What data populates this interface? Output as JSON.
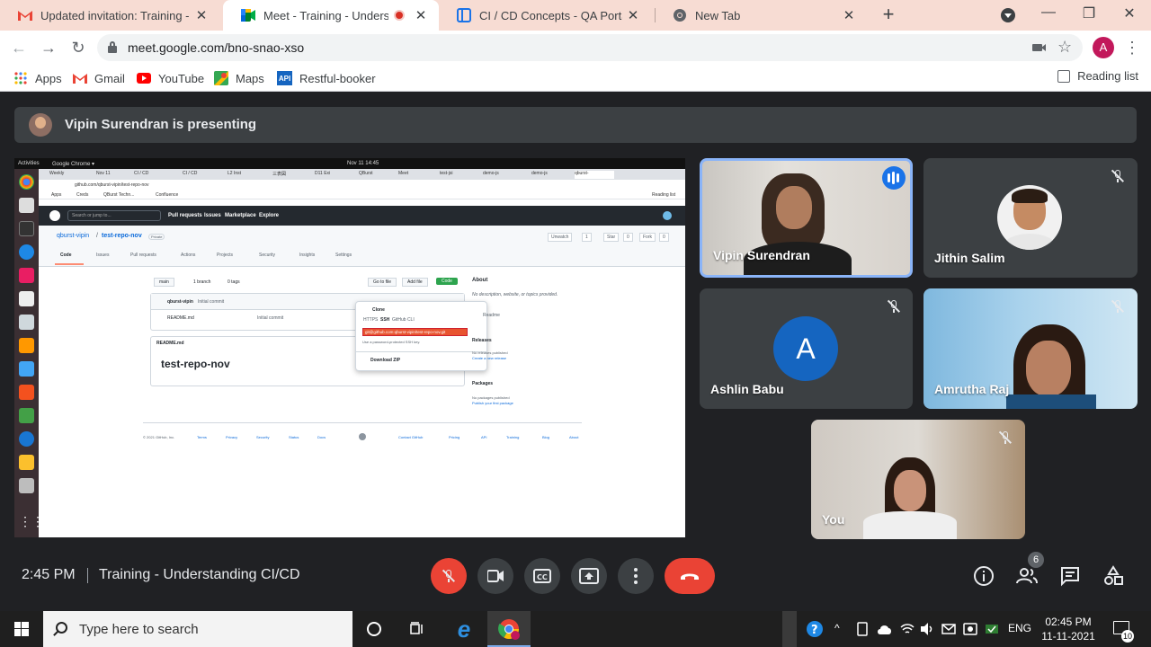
{
  "browser": {
    "tabs": [
      {
        "title": "Updated invitation: Training - Un",
        "icon": "gmail-icon",
        "active": false
      },
      {
        "title": "Meet - Training - Understand",
        "icon": "meet-icon",
        "active": true,
        "recording": true
      },
      {
        "title": "CI / CD Concepts - QA Portal",
        "icon": "portal-icon",
        "active": false
      },
      {
        "title": "New Tab",
        "icon": "chrome-icon",
        "active": false
      }
    ],
    "new_tab_label": "+",
    "url": "meet.google.com/bno-snao-xso",
    "profile_initial": "A",
    "bookmarks": [
      {
        "label": "Apps",
        "icon": "apps-grid-icon"
      },
      {
        "label": "Gmail",
        "icon": "gmail-icon"
      },
      {
        "label": "YouTube",
        "icon": "youtube-icon"
      },
      {
        "label": "Maps",
        "icon": "maps-icon"
      },
      {
        "label": "Restful-booker",
        "icon": "api-icon"
      }
    ],
    "api_badge": "API",
    "reading_list": "Reading list"
  },
  "meet": {
    "presenting_text": "Vipin Surendran is presenting",
    "participants": [
      {
        "name": "Vipin Surendran",
        "speaking": true
      },
      {
        "name": "Jithin Salim",
        "muted": true
      },
      {
        "name": "Ashlin Babu",
        "muted": true,
        "initial": "A"
      },
      {
        "name": "Amrutha Raj",
        "muted": true
      },
      {
        "name": "You",
        "muted": true
      }
    ],
    "time": "2:45 PM",
    "separator": "|",
    "meeting_title": "Training - Understanding CI/CD",
    "people_count": "6"
  },
  "shared_screen": {
    "topbar": {
      "activities": "Activities",
      "app": "Google Chrome ▾",
      "clock": "Nov 11  14:45"
    },
    "tabs": [
      "Weekly",
      "Nov 11",
      "CI / CD",
      "CI / CD",
      "L2 Inst",
      "三表図",
      "D11 Exi",
      "QBurst",
      "Meet",
      "test-jsi",
      "demo-js",
      "demo-js",
      "qburst-"
    ],
    "url": "github.com/qburst-vipin/test-repo-nov",
    "bookmarks": [
      "Apps",
      "Creds",
      "QBurst Techn...",
      "Confluence"
    ],
    "reading_list": "Reading list",
    "gh_search": "Search or jump to...",
    "gh_nav": [
      "Pull requests",
      "Issues",
      "Marketplace",
      "Explore"
    ],
    "repo_owner": "qburst-vipin",
    "repo_name": "test-repo-nov",
    "repo_visibility": "Private",
    "repo_actions": [
      "Unwatch",
      "1",
      "Star",
      "0",
      "Fork",
      "0"
    ],
    "repo_tabs": [
      "Code",
      "Issues",
      "Pull requests",
      "Actions",
      "Projects",
      "Security",
      "Insights",
      "Settings"
    ],
    "branch": "main",
    "branches": "1 branch",
    "tags": "0 tags",
    "buttons": {
      "goto": "Go to file",
      "add": "Add file",
      "code": "Code"
    },
    "commit_author": "qburst-vipin",
    "commit_msg": "Initial commit",
    "file_name": "README.md",
    "file_commit": "Initial commit",
    "readme_label": "README.md",
    "readme_title": "test-repo-nov",
    "clone": {
      "title": "Clone",
      "tabs": [
        "HTTPS",
        "SSH",
        "GitHub CLI"
      ],
      "url": "git@github.com:qburst-vipin/test-repo-nov.git",
      "hint": "Use a password-protected SSH key.",
      "download": "Download ZIP"
    },
    "about": {
      "title": "About",
      "desc": "No description, website, or topics provided.",
      "readme": "Readme"
    },
    "releases": {
      "title": "Releases",
      "text": "No releases published",
      "link": "Create a new release"
    },
    "packages": {
      "title": "Packages",
      "text": "No packages published",
      "link": "Publish your first package"
    },
    "footer": [
      "© 2021 GitHub, Inc.",
      "Terms",
      "Privacy",
      "Security",
      "Status",
      "Docs",
      "Contact GitHub",
      "Pricing",
      "API",
      "Training",
      "Blog",
      "About"
    ]
  },
  "taskbar": {
    "search_placeholder": "Type here to search",
    "language": "ENG",
    "time": "02:45 PM",
    "date": "11-11-2021",
    "notification_count": "10"
  },
  "colors": {
    "accent": "#1a73e8",
    "danger": "#ea4335",
    "meet_bg": "#202124",
    "tile_bg": "#3c4043"
  }
}
